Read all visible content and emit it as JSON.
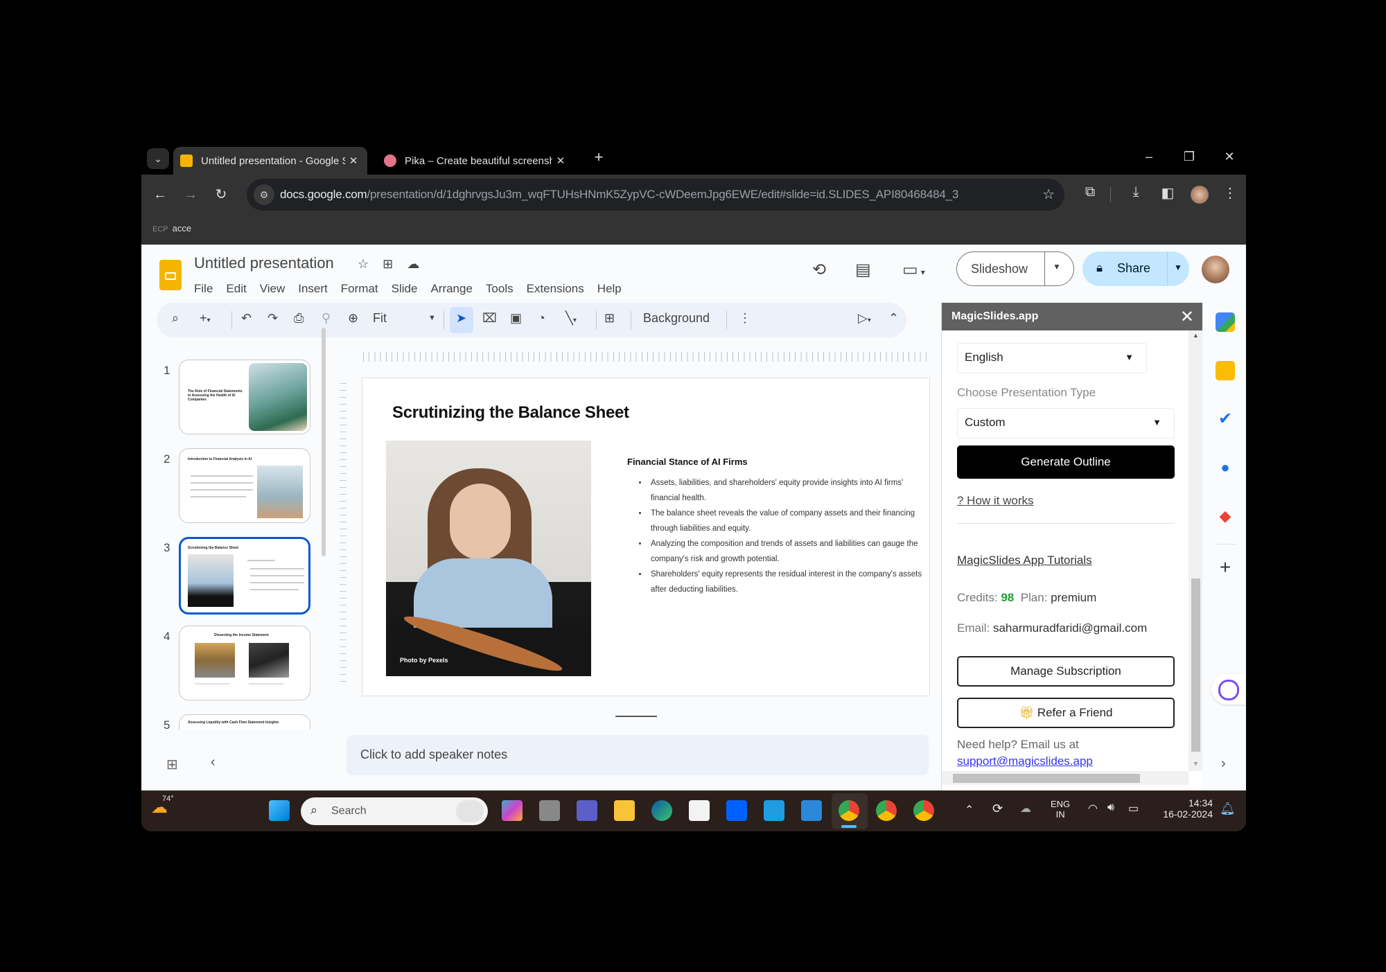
{
  "browser": {
    "tabs": [
      {
        "title": "Untitled presentation - Google Slides",
        "icon": "slides-favicon",
        "active": true
      },
      {
        "title": "Pika – Create beautiful screenshots",
        "icon": "pika-favicon",
        "active": false
      }
    ],
    "new_tab_label": "+",
    "window_controls": {
      "minimize": "–",
      "restore": "❐",
      "close": "✕"
    },
    "url_host": "docs.google.com",
    "url_path": "/presentation/d/1dghrvgsJu3m_wqFTUHsHNmK5ZypVC-cWDeemJpg6EWE/edit#slide=id.SLIDES_API80468484_3",
    "bookmark": {
      "icon": "ECP",
      "label": "acce"
    }
  },
  "slides_app": {
    "doc_title": "Untitled presentation",
    "menu": [
      "File",
      "Edit",
      "View",
      "Insert",
      "Format",
      "Slide",
      "Arrange",
      "Tools",
      "Extensions",
      "Help"
    ],
    "slideshow_label": "Slideshow",
    "share_label": "Share",
    "toolbar": {
      "zoom_value": "Fit",
      "background_label": "Background"
    },
    "thumbnails": [
      {
        "num": "1",
        "title": "The Role of Financial Statements in Assessing the Health of AI Companies"
      },
      {
        "num": "2",
        "title": "Introduction to Financial Analysis in AI"
      },
      {
        "num": "3",
        "title": "Scrutinizing the Balance Sheet",
        "selected": true
      },
      {
        "num": "4",
        "title": "Dissecting the Income Statement"
      },
      {
        "num": "5",
        "title": "Assessing Liquidity with Cash Flow Statement Insights"
      }
    ],
    "slide": {
      "title": "Scrutinizing the Balance Sheet",
      "subtitle": "Financial Stance of AI Firms",
      "photo_credit": "Photo by Pexels",
      "bullets": [
        "Assets, liabilities, and shareholders' equity provide insights into AI firms' financial health.",
        "The balance sheet reveals the value of company assets and their financing through liabilities and equity.",
        "Analyzing the composition and trends of assets and liabilities can gauge the company's risk and growth potential.",
        "Shareholders' equity represents the residual interest in the company's assets after deducting liabilities."
      ]
    },
    "speaker_notes_placeholder": "Click to add speaker notes"
  },
  "magicslides": {
    "title": "MagicSlides.app",
    "language_value": "English",
    "type_label": "Choose Presentation Type",
    "type_value": "Custom",
    "generate_label": "Generate Outline",
    "how_it_works": "? How it works",
    "tutorials": "MagicSlides App Tutorials",
    "credits_label": "Credits:",
    "credits_value": "98",
    "plan_label": "Plan:",
    "plan_value": "premium",
    "email_label": "Email:",
    "email_value": "saharmuradfaridi@gmail.com",
    "manage_label": "Manage Subscription",
    "refer_label": "Refer a Friend",
    "help_text": "Need help? Email us at",
    "support_email": "support@magicslides.app"
  },
  "taskbar": {
    "weather": "74°",
    "search_placeholder": "Search",
    "lang_top": "ENG",
    "lang_bottom": "IN",
    "time": "14:34",
    "date": "16-02-2024"
  }
}
